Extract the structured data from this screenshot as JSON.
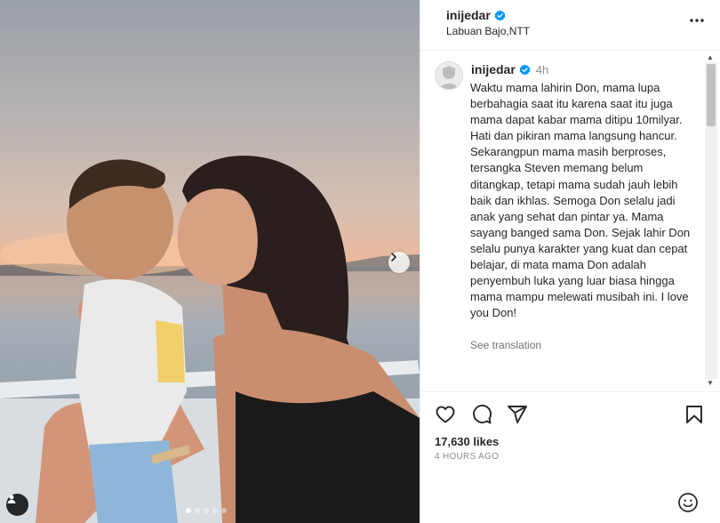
{
  "post": {
    "username": "inijedar",
    "location": "Labuan Bajo,NTT",
    "time_ago_short": "4h",
    "caption": "Waktu mama lahirin Don, mama lupa berbahagia saat itu karena saat itu juga mama dapat kabar mama ditipu 10milyar. Hati dan pikiran mama langsung hancur. Sekarangpun mama masih berproses, tersangka Steven memang belum ditangkap, tetapi mama sudah jauh lebih baik dan ikhlas. Semoga Don selalu jadi anak yang sehat dan pintar ya. Mama sayang banged sama Don. Sejak lahir Don selalu punya karakter yang kuat dan cepat belajar, di mata mama Don adalah penyembuh luka yang luar biasa hingga mama mampu melewati musibah ini. I love you Don!",
    "see_translation": "See translation",
    "likes": "17,630 likes",
    "time_ago_long": "4 HOURS AGO"
  },
  "carousel": {
    "total": 5,
    "active_index": 0
  },
  "icons": {
    "more": "more-horizontal-icon",
    "verified": "verified-badge-icon",
    "like": "heart-icon",
    "comment": "comment-icon",
    "share": "send-icon",
    "save": "bookmark-icon",
    "emoji": "emoji-icon",
    "next": "chevron-right-icon",
    "tag": "user-tag-icon"
  },
  "colors": {
    "verified": "#0095f6",
    "text": "#262626",
    "muted": "#8e8e8e"
  }
}
